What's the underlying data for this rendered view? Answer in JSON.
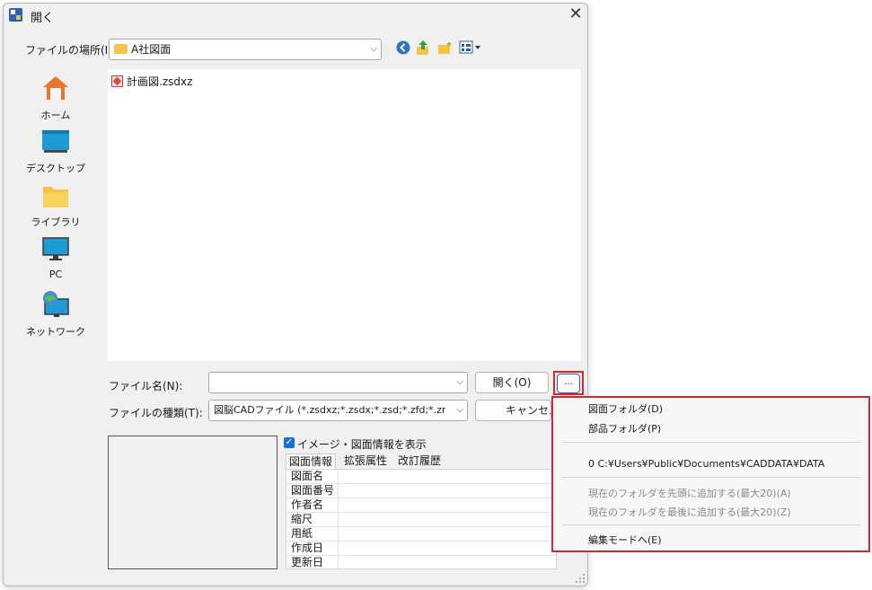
{
  "window": {
    "title": "開く",
    "close_glyph": "✕"
  },
  "location": {
    "label": "ファイルの場所(I):",
    "value": "A社図面",
    "arrow": "⌵"
  },
  "toolbar": {
    "icons": [
      "back-icon",
      "up-folder-icon",
      "new-folder-icon",
      "view-menu-icon"
    ]
  },
  "sidebar": {
    "items": [
      {
        "label": "ホーム",
        "icon": "home-icon"
      },
      {
        "label": "デスクトップ",
        "icon": "desktop-icon"
      },
      {
        "label": "ライブラリ",
        "icon": "library-icon"
      },
      {
        "label": "PC",
        "icon": "pc-icon"
      },
      {
        "label": "ネットワーク",
        "icon": "network-icon"
      }
    ]
  },
  "files": [
    {
      "name": "計画図.zsdxz",
      "icon": "zsdxz-file-icon"
    }
  ],
  "filename": {
    "label": "ファイル名(N):",
    "value": "",
    "arrow": "⌵"
  },
  "filetype": {
    "label": "ファイルの種類(T):",
    "value": "図脳CADファイル (*.zsdxz;*.zsdx;*.zsd;*.zfd;*.zrd;*.zsc",
    "arrow": "⌵"
  },
  "buttons": {
    "open": "開く(O)",
    "cancel": "キャンセル",
    "more": "..."
  },
  "preview": {
    "checkbox_label": "イメージ・図面情報を表示",
    "checkbox_mark": "✓",
    "tabs": [
      "図面情報",
      "拡張属性",
      "改訂履歴"
    ],
    "fields": [
      "図面名",
      "図面番号",
      "作者名",
      "縮尺",
      "用紙",
      "作成日",
      "更新日"
    ]
  },
  "popup_menu": {
    "items": [
      {
        "label": "図面フォルダ(D)",
        "enabled": true
      },
      {
        "label": "部品フォルダ(P)",
        "enabled": true
      },
      {
        "label": "0 C:¥Users¥Public¥Documents¥CADDATA¥DATA",
        "enabled": true
      },
      {
        "label": "現在のフォルダを先頭に追加する(最大20)(A)",
        "enabled": false
      },
      {
        "label": "現在のフォルダを最後に追加する(最大20)(Z)",
        "enabled": false
      },
      {
        "label": "編集モードへ(E)",
        "enabled": true
      }
    ]
  },
  "colors": {
    "highlight_border": "#d9252e",
    "accent": "#1a6ed8"
  }
}
